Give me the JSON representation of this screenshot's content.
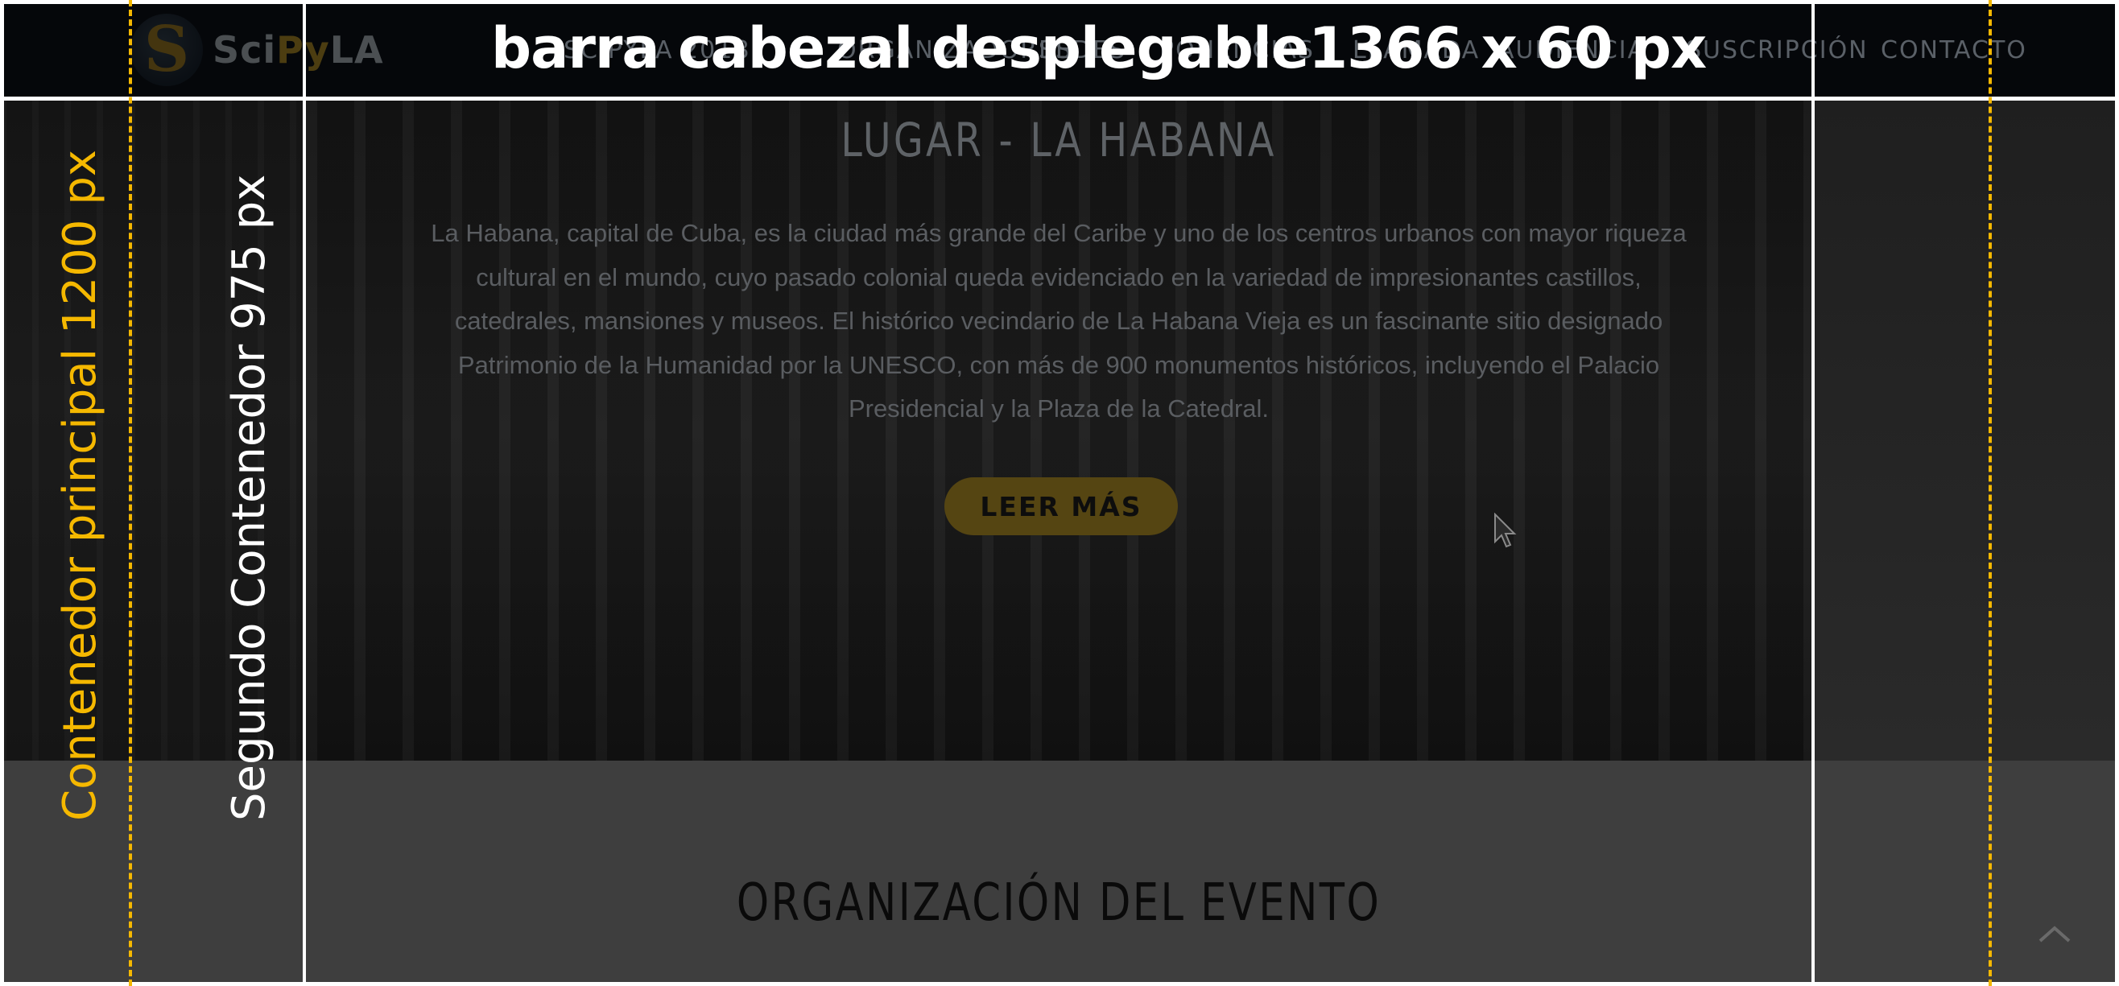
{
  "header": {
    "logo": {
      "prefix": "Sci",
      "highlight": "Py",
      "suffix": "LA"
    },
    "nav": [
      {
        "label": "SciPyLA 2018"
      },
      {
        "label": "Organizadores"
      },
      {
        "label": "Sedes"
      },
      {
        "label": "Ponencias"
      },
      {
        "label": "Llamada"
      },
      {
        "label": "Audiencia"
      },
      {
        "label": "Suscripción"
      },
      {
        "label": "Contacto"
      }
    ],
    "overlay_label": "barra cabezal desplegable1366 x 60 px"
  },
  "hero": {
    "title": "LUGAR - LA HABANA",
    "body": "La Habana, capital de Cuba, es la ciudad más grande del Caribe y uno de los centros urbanos con mayor riqueza cultural en el mundo, cuyo pasado colonial queda evidenciado en la variedad de impresionantes castillos, catedrales, mansiones y museos. El histórico vecindario de La Habana Vieja es un fascinante sitio designado Patrimonio de la Humanidad por la UNESCO, con más de 900 monumentos históricos, incluyendo el Palacio Presidencial y la Plaza de la Catedral.",
    "button_label": "LEER MÁS"
  },
  "organization": {
    "title": "ORGANIZACIÓN DEL EVENTO"
  },
  "annotations": {
    "main_container": "Contenedor principal 1200 px",
    "second_container": "Segundo Contenedor  975 px"
  },
  "colors": {
    "accent": "#f5b800",
    "button": "#554512",
    "header_bg": "#05070a",
    "org_bg": "#3e3e3e"
  },
  "icons": [
    "scipyla-logo-icon",
    "cursor-icon",
    "chevron-up-icon"
  ]
}
